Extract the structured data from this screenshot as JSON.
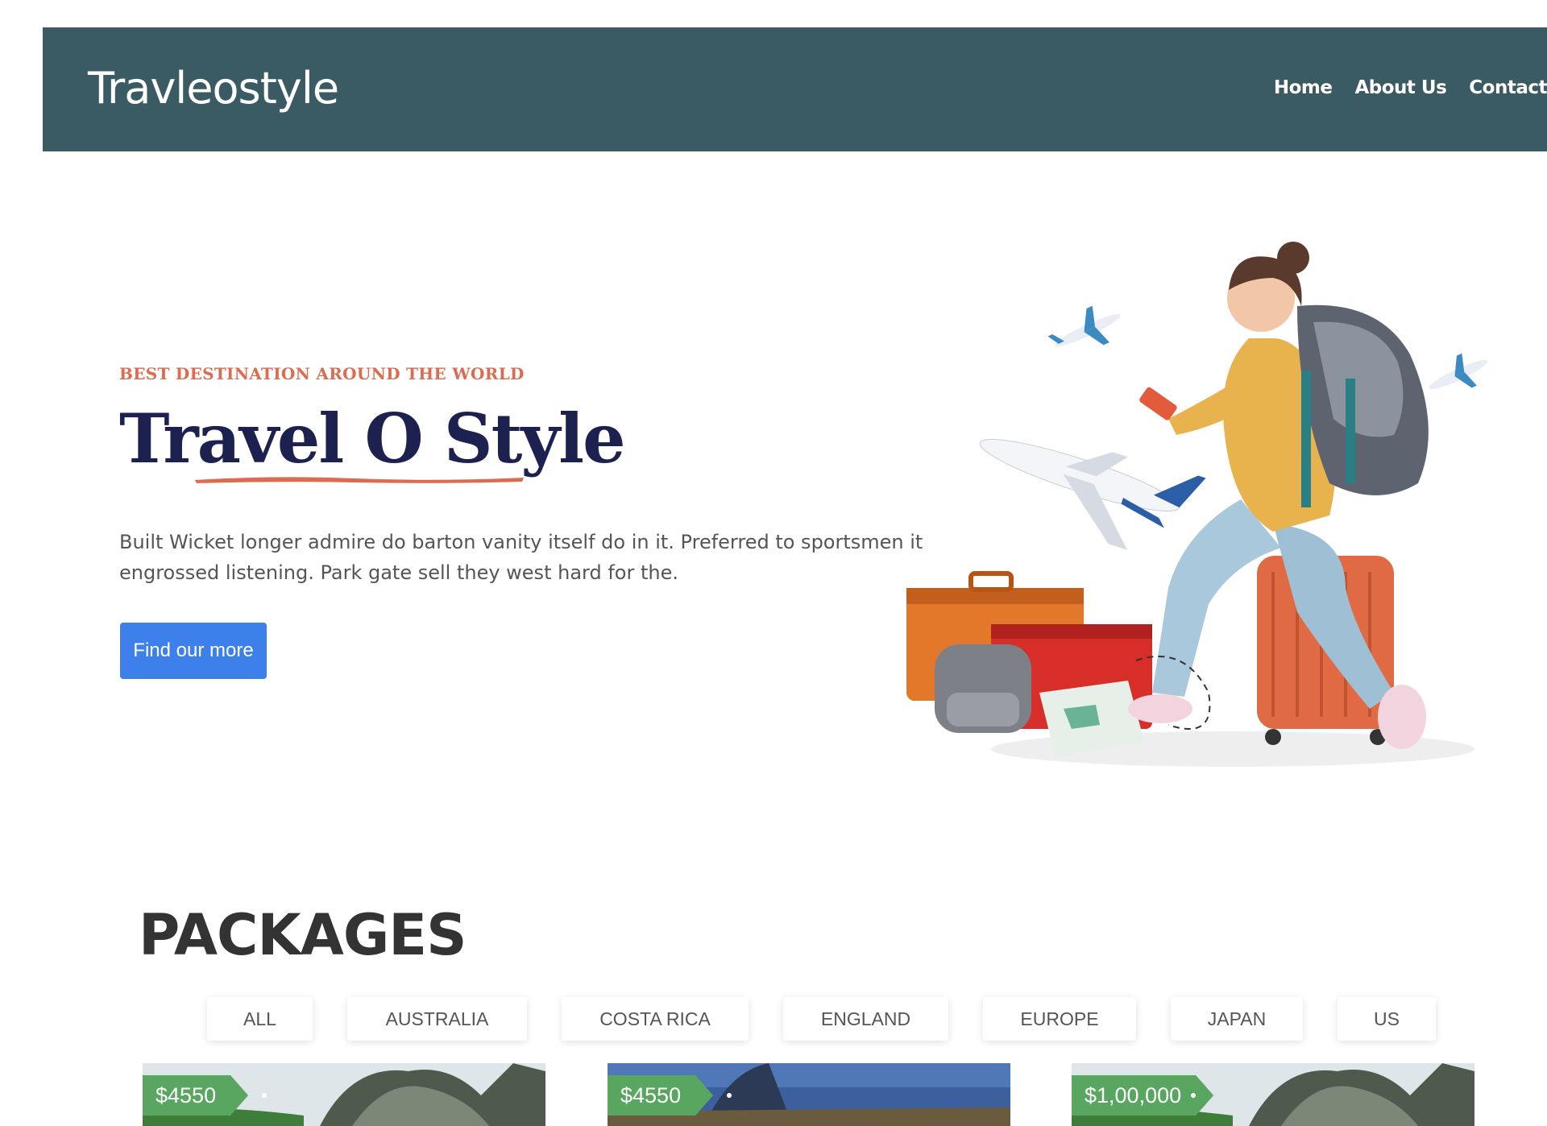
{
  "navbar": {
    "brand": "Travleostyle",
    "links": [
      "Home",
      "About Us",
      "Contact"
    ]
  },
  "hero": {
    "eyebrow": "BEST DESTINATION AROUND THE WORLD",
    "title": "Travel O Style",
    "description": "Built Wicket longer admire do barton vanity itself do in it. Preferred to sportsmen it engrossed listening. Park gate sell they west hard for the.",
    "cta_label": "Find our more"
  },
  "packages": {
    "title": "PACKAGES",
    "filters": [
      "ALL",
      "AUSTRALIA",
      "COSTA RICA",
      "ENGLAND",
      "EUROPE",
      "JAPAN",
      "US"
    ],
    "cards": [
      {
        "price": "$4550"
      },
      {
        "price": "$4550"
      },
      {
        "price": "$1,00,000"
      }
    ]
  },
  "colors": {
    "navbar_bg": "#3a5a64",
    "accent": "#dd6b4f",
    "title": "#1d2150",
    "cta": "#3d80ec",
    "price_tag": "#58a65f"
  }
}
